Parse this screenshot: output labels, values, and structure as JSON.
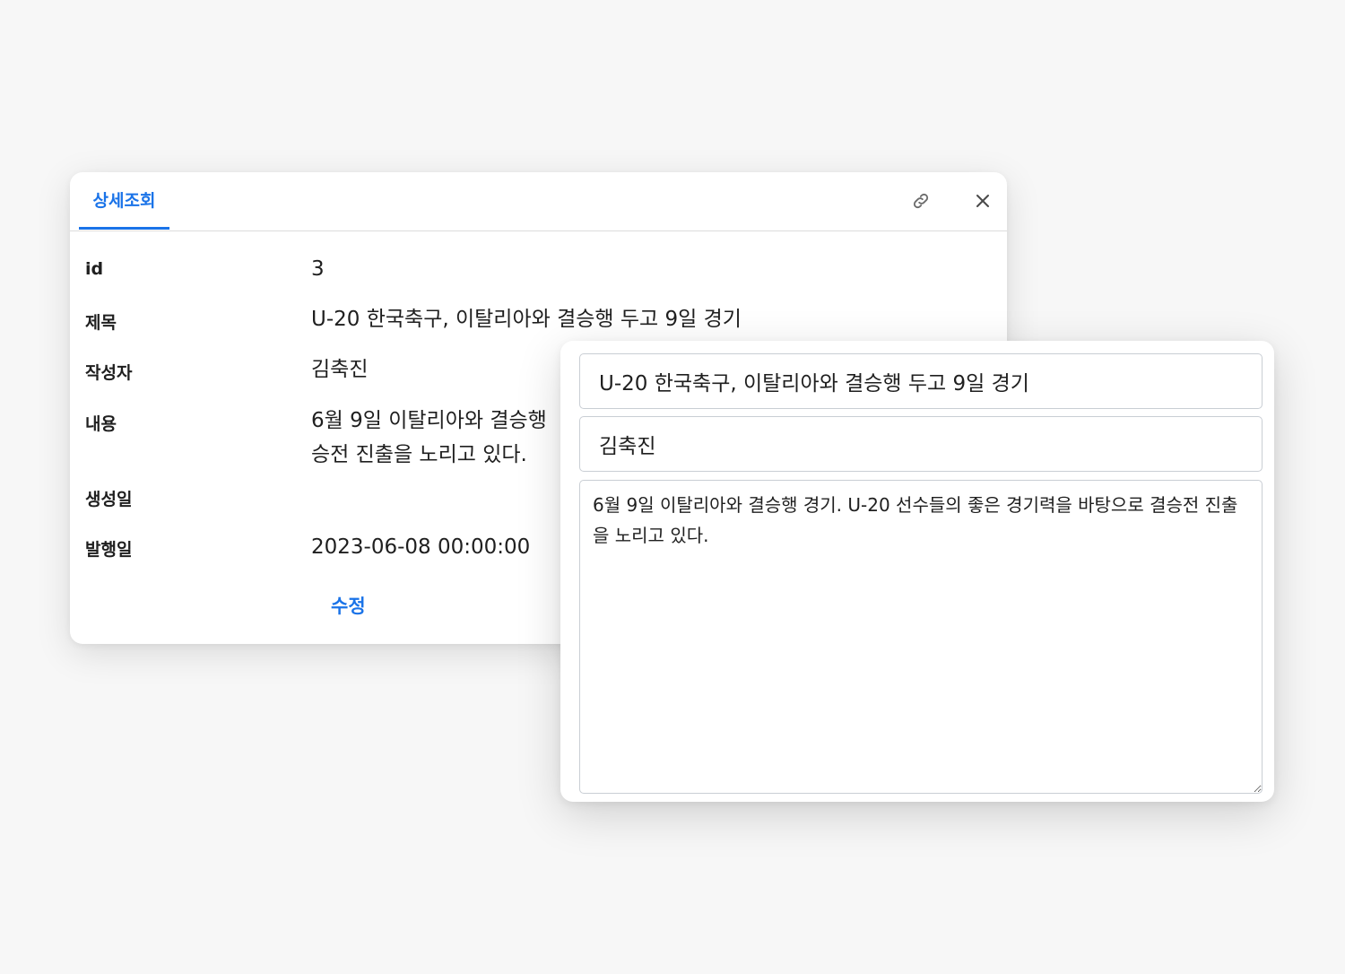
{
  "detail": {
    "tab_label": "상세조회",
    "icons": {
      "link": "link-icon",
      "close": "close-icon"
    },
    "fields": {
      "id": {
        "label": "id",
        "value": "3"
      },
      "title": {
        "label": "제목",
        "value": "U-20 한국축구, 이탈리아와 결승행 두고 9일 경기"
      },
      "author": {
        "label": "작성자",
        "value": "김축진"
      },
      "content": {
        "label": "내용",
        "value": "6월 9일 이탈리아와 결승행\n승전 진출을 노리고 있다."
      },
      "created": {
        "label": "생성일",
        "value": ""
      },
      "published": {
        "label": "발행일",
        "value": "2023-06-08 00:00:00"
      }
    },
    "edit_label": "수정"
  },
  "edit_form": {
    "title_value": "U-20 한국축구, 이탈리아와 결승행 두고 9일 경기",
    "author_value": "김축진",
    "content_value": "6월 9일 이탈리아와 결승행 경기. U-20 선수들의 좋은 경기력을 바탕으로 결승전 진출을 노리고 있다."
  },
  "colors": {
    "accent": "#1a73e8",
    "background": "#f7f7f7",
    "panel": "#ffffff",
    "input_border": "#c9ced4"
  }
}
